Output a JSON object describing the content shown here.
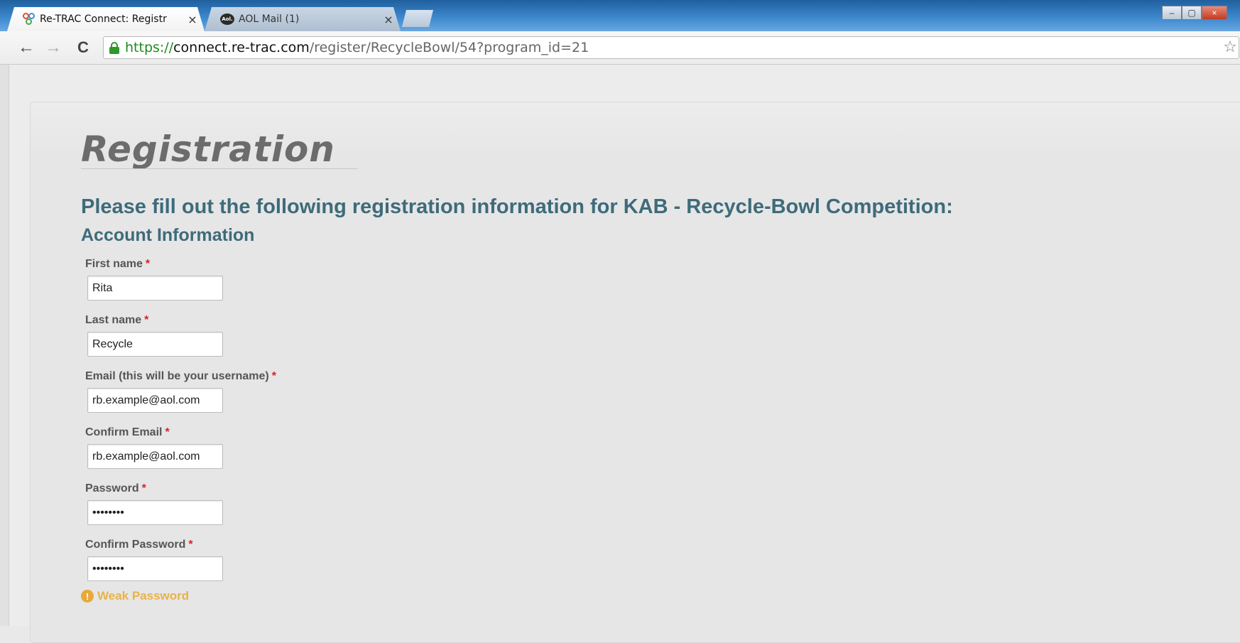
{
  "browser": {
    "tabs": [
      {
        "title": "Re-TRAC Connect: Registr",
        "icon": "retrac-favicon",
        "close": "×"
      },
      {
        "title": "AOL Mail (1)",
        "icon": "aol-favicon",
        "icon_text": "Aol.",
        "close": "×"
      }
    ],
    "url": {
      "scheme": "https://",
      "host": "connect.re-trac.com",
      "path": "/register/RecycleBowl/54?program_id=21"
    },
    "nav": {
      "back": "←",
      "forward": "→",
      "reload": "C",
      "bookmark": "☆"
    },
    "window_controls": {
      "minimize": "–",
      "maximize": "▢",
      "close": "×"
    }
  },
  "page": {
    "title": "Registration",
    "intro": "Please fill out the following registration information for KAB - Recycle-Bowl Competition:",
    "section": "Account Information",
    "required_marker": "*",
    "fields": {
      "first_name": {
        "label": "First name",
        "value": "Rita"
      },
      "last_name": {
        "label": "Last name",
        "value": "Recycle"
      },
      "email": {
        "label": "Email (this will be your username)",
        "value": "rb.example@aol.com"
      },
      "confirm_email": {
        "label": "Confirm Email",
        "value": "rb.example@aol.com"
      },
      "password": {
        "label": "Password",
        "value": "••••••••"
      },
      "confirm_password": {
        "label": "Confirm Password",
        "value": "••••••••"
      }
    },
    "password_strength": {
      "icon": "!",
      "text": "Weak Password"
    }
  },
  "colors": {
    "heading": "#3e6b7a",
    "required": "#dd2222",
    "warning": "#e8b34a",
    "secure_url": "#1e8b1e"
  }
}
